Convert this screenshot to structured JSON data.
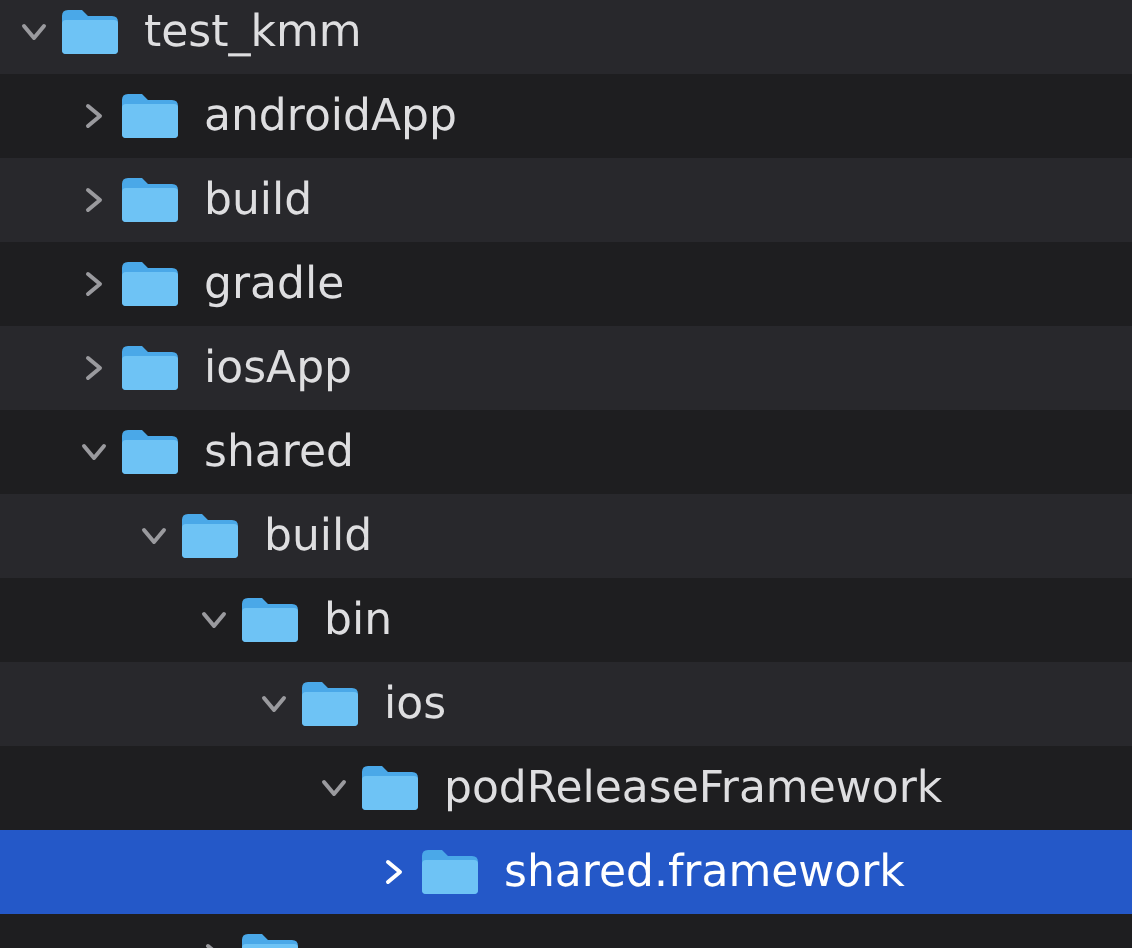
{
  "tree": [
    {
      "name": "test_kmm",
      "expanded": true,
      "selected": false,
      "children": [
        {
          "name": "androidApp",
          "expanded": false,
          "selected": false
        },
        {
          "name": "build",
          "expanded": false,
          "selected": false
        },
        {
          "name": "gradle",
          "expanded": false,
          "selected": false
        },
        {
          "name": "iosApp",
          "expanded": false,
          "selected": false
        },
        {
          "name": "shared",
          "expanded": true,
          "selected": false,
          "children": [
            {
              "name": "build",
              "expanded": true,
              "selected": false,
              "children": [
                {
                  "name": "bin",
                  "expanded": true,
                  "selected": false,
                  "children": [
                    {
                      "name": "ios",
                      "expanded": true,
                      "selected": false,
                      "children": [
                        {
                          "name": "podReleaseFramework",
                          "expanded": true,
                          "selected": false,
                          "children": [
                            {
                              "name": "shared.framework",
                              "expanded": false,
                              "selected": true
                            }
                          ]
                        }
                      ]
                    }
                  ]
                },
                {
                  "expanded": false,
                  "selected": false
                }
              ]
            }
          ]
        }
      ]
    }
  ]
}
